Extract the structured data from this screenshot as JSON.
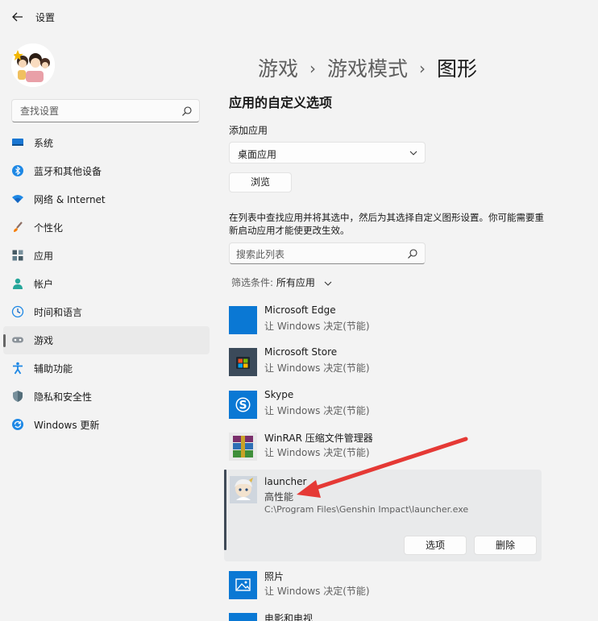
{
  "window": {
    "title": "设置"
  },
  "sidebar": {
    "search_placeholder": "查找设置",
    "items": [
      {
        "label": "系统",
        "icon": "monitor-icon"
      },
      {
        "label": "蓝牙和其他设备",
        "icon": "bluetooth-icon"
      },
      {
        "label": "网络 & Internet",
        "icon": "wifi-icon"
      },
      {
        "label": "个性化",
        "icon": "brush-icon"
      },
      {
        "label": "应用",
        "icon": "apps-icon"
      },
      {
        "label": "帐户",
        "icon": "person-icon"
      },
      {
        "label": "时间和语言",
        "icon": "clock-globe-icon"
      },
      {
        "label": "游戏",
        "icon": "gamepad-icon",
        "active": true
      },
      {
        "label": "辅助功能",
        "icon": "accessibility-icon"
      },
      {
        "label": "隐私和安全性",
        "icon": "shield-icon"
      },
      {
        "label": "Windows 更新",
        "icon": "update-icon"
      }
    ]
  },
  "breadcrumb": {
    "level1": "游戏",
    "level2": "游戏模式",
    "level3": "图形",
    "separator": "›"
  },
  "main": {
    "section_title": "应用的自定义选项",
    "add_app_label": "添加应用",
    "dropdown_value": "桌面应用",
    "browse_label": "浏览",
    "description": "在列表中查找应用并将其选中，然后为其选择自定义图形设置。你可能需要重新启动应用才能使更改生效。",
    "list_search_placeholder": "搜索此列表",
    "filter_prefix": "筛选条件:",
    "filter_value": "所有应用"
  },
  "apps": [
    {
      "name": "Microsoft Edge",
      "pref": "让 Windows 决定(节能)",
      "icon": "edge-icon",
      "color": "#0a78d4"
    },
    {
      "name": "Microsoft Store",
      "pref": "让 Windows 决定(节能)",
      "icon": "store-icon",
      "color": "#3b4a5a"
    },
    {
      "name": "Skype",
      "pref": "让 Windows 决定(节能)",
      "icon": "skype-icon",
      "color": "#0a78d4"
    },
    {
      "name": "WinRAR 压缩文件管理器",
      "pref": "让 Windows 决定(节能)",
      "icon": "winrar-icon",
      "color": "#7a2f6b"
    }
  ],
  "selected_app": {
    "name": "launcher",
    "pref": "高性能",
    "path": "C:\\Program Files\\Genshin Impact\\launcher.exe",
    "options_label": "选项",
    "delete_label": "删除"
  },
  "apps_below": [
    {
      "name": "照片",
      "pref": "让 Windows 决定(节能)",
      "icon": "photos-icon",
      "color": "#0a78d4"
    },
    {
      "name": "电影和电视",
      "pref": "",
      "icon": "movies-icon",
      "color": "#0a78d4"
    }
  ],
  "colors": {
    "accent": "#0a78d4",
    "annotation_arrow": "#e53935",
    "background": "#f3f3f3"
  }
}
